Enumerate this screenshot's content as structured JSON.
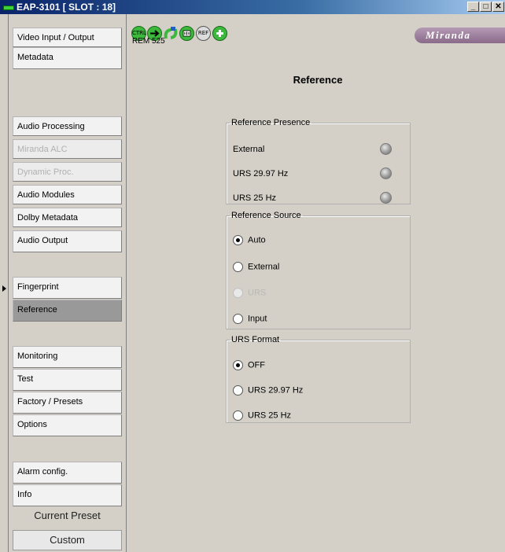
{
  "window": {
    "title": "EAP-3101 [ SLOT : 18]",
    "buttons": [
      "minimize",
      "maximize",
      "close"
    ]
  },
  "toolbar": {
    "icons": [
      "ctrl-icon",
      "arrow-right-icon",
      "arrows-icon",
      "audio-icon",
      "ref-icon",
      "plus-icon"
    ],
    "ctrl_label": "CTRL",
    "ref_label": "REF",
    "rem_text": "REM 525",
    "logo_text": "Miranda"
  },
  "nav": {
    "items": [
      {
        "label": "Video Input / Output",
        "state": "normal"
      },
      {
        "label": "Metadata",
        "state": "normal"
      },
      {
        "label": "Audio Processing",
        "state": "normal"
      },
      {
        "label": "Miranda ALC",
        "state": "disabled"
      },
      {
        "label": "Dynamic Proc.",
        "state": "disabled"
      },
      {
        "label": "Audio Modules",
        "state": "normal"
      },
      {
        "label": "Dolby Metadata",
        "state": "normal"
      },
      {
        "label": "Audio Output",
        "state": "normal"
      },
      {
        "label": "Fingerprint",
        "state": "normal"
      },
      {
        "label": "Reference",
        "state": "selected"
      },
      {
        "label": "Monitoring",
        "state": "normal"
      },
      {
        "label": "Test",
        "state": "normal"
      },
      {
        "label": "Factory / Presets",
        "state": "normal"
      },
      {
        "label": "Options",
        "state": "normal"
      },
      {
        "label": "Alarm config.",
        "state": "normal"
      },
      {
        "label": "Info",
        "state": "normal"
      }
    ],
    "current_preset_label": "Current Preset",
    "current_preset_value": "Custom"
  },
  "main": {
    "page_title": "Reference",
    "reference_presence": {
      "legend": "Reference Presence",
      "items": [
        {
          "label": "External",
          "status": "inactive"
        },
        {
          "label": "URS 29.97 Hz",
          "status": "inactive"
        },
        {
          "label": "URS 25 Hz",
          "status": "inactive"
        }
      ]
    },
    "reference_source": {
      "legend": "Reference Source",
      "options": [
        {
          "label": "Auto",
          "checked": true,
          "disabled": false
        },
        {
          "label": "External",
          "checked": false,
          "disabled": false
        },
        {
          "label": "URS",
          "checked": false,
          "disabled": true
        },
        {
          "label": "Input",
          "checked": false,
          "disabled": false
        }
      ]
    },
    "urs_format": {
      "legend": "URS Format",
      "options": [
        {
          "label": "OFF",
          "checked": true,
          "disabled": false
        },
        {
          "label": "URS 29.97 Hz",
          "checked": false,
          "disabled": false
        },
        {
          "label": "URS 25 Hz",
          "checked": false,
          "disabled": false
        }
      ]
    }
  },
  "colors": {
    "selected_nav": "#999999",
    "led_inactive": "#9a9a9a",
    "toolbar_green": "#3cb83c"
  }
}
